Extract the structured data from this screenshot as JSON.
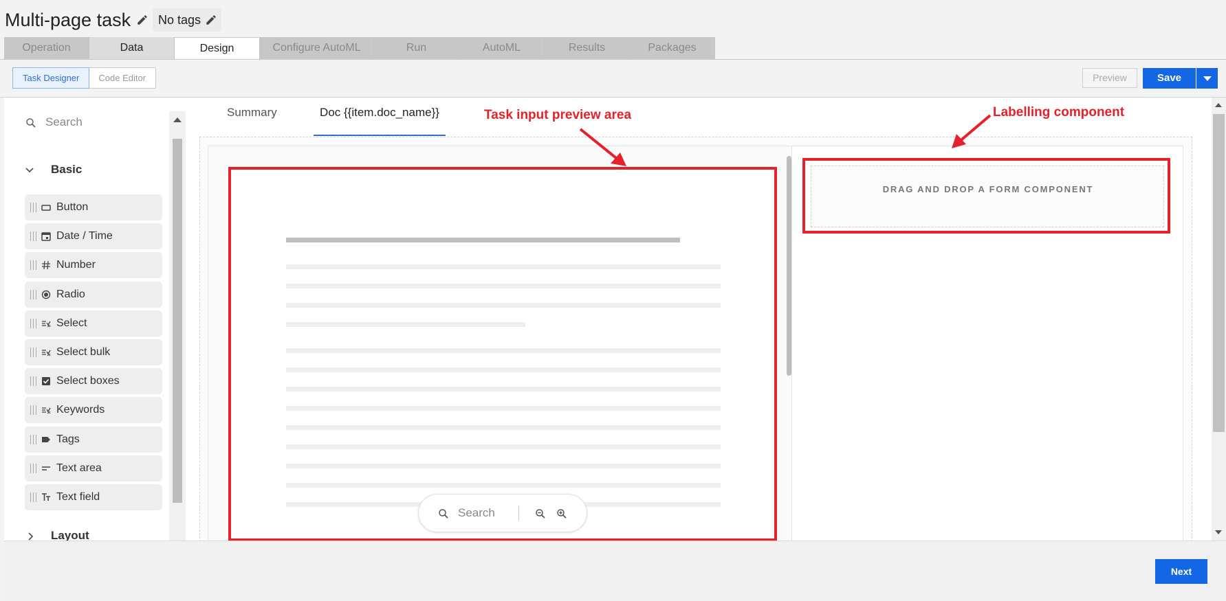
{
  "header": {
    "title": "Multi-page task",
    "tags_label": "No tags",
    "edit_icon": "pencil-icon"
  },
  "main_tabs": [
    {
      "label": "Operation"
    },
    {
      "label": "Data"
    },
    {
      "label": "Design"
    },
    {
      "label": "Configure AutoML"
    },
    {
      "label": "Run"
    },
    {
      "label": "AutoML"
    },
    {
      "label": "Results"
    },
    {
      "label": "Packages"
    }
  ],
  "toolbar": {
    "task_designer": "Task Designer",
    "code_editor": "Code Editor",
    "preview": "Preview",
    "save": "Save"
  },
  "palette": {
    "search_placeholder": "Search",
    "basic_label": "Basic",
    "layout_label": "Layout",
    "items": [
      {
        "label": "Button",
        "icon": "button-icon"
      },
      {
        "label": "Date / Time",
        "icon": "calendar-icon"
      },
      {
        "label": "Number",
        "icon": "hash-icon"
      },
      {
        "label": "Radio",
        "icon": "radio-icon"
      },
      {
        "label": "Select",
        "icon": "select-list-icon"
      },
      {
        "label": "Select bulk",
        "icon": "select-list-icon"
      },
      {
        "label": "Select boxes",
        "icon": "checkbox-icon"
      },
      {
        "label": "Keywords",
        "icon": "select-list-icon"
      },
      {
        "label": "Tags",
        "icon": "tag-icon"
      },
      {
        "label": "Text area",
        "icon": "text-area-icon"
      },
      {
        "label": "Text field",
        "icon": "text-field-icon"
      }
    ]
  },
  "canvas": {
    "tab_summary": "Summary",
    "tab_doc": "Doc {{item.doc_name}}",
    "drop_label": "DRAG AND DROP A FORM COMPONENT",
    "doc_search_placeholder": "Search"
  },
  "annotations": {
    "left": "Task input preview area",
    "right": "Labelling component",
    "color": "#e5212b"
  },
  "footer": {
    "next": "Next"
  },
  "colors": {
    "primary": "#1366e4",
    "active_tab_underline": "#2f6fd6"
  }
}
